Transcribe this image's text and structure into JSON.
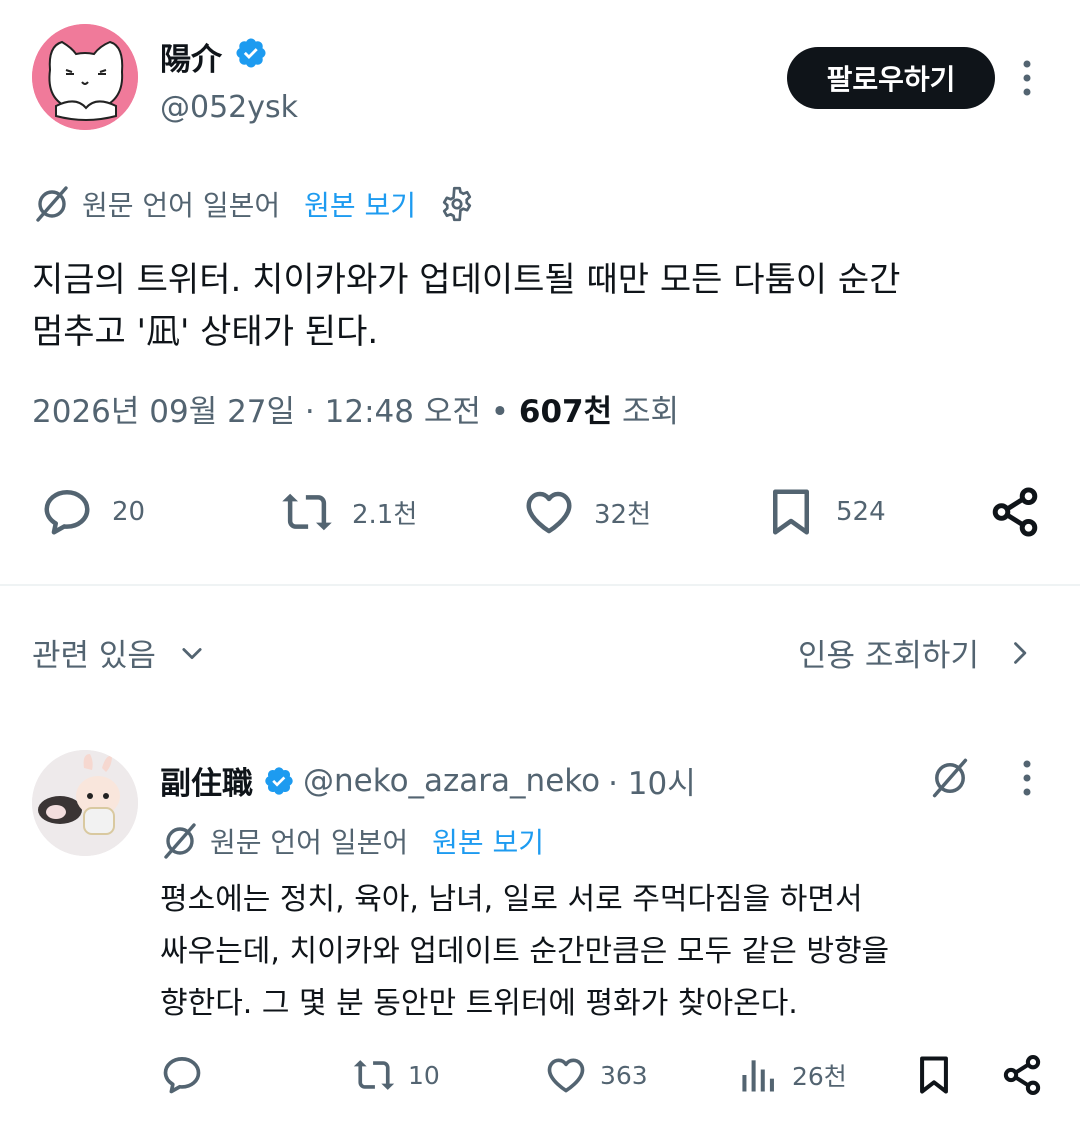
{
  "tweet": {
    "author_name": "陽介",
    "author_handle": "@052ysk",
    "follow_label": "팔로우하기",
    "translation": {
      "source_label": "원문 언어 일본어",
      "show_original": "원본 보기"
    },
    "body_line1": "지금의 트위터. 치이카와가 업데이트될 때만 모든 다툼이 순간",
    "body_line2": "멈추고 '凪' 상태가 된다.",
    "date": "2026년 09월 27일",
    "time": "12:48 오전",
    "views_count": "607천",
    "views_label": "조회",
    "sep": "·",
    "dot": "•",
    "replies": "20",
    "retweets": "2.1천",
    "likes": "32천",
    "bookmarks": "524"
  },
  "related_label": "관련 있음",
  "quote_views_label": "인용 조회하기",
  "reply": {
    "author_name": "副住職",
    "author_handle": "@neko_azara_neko",
    "time": "· 10시",
    "translation": {
      "source_label": "원문 언어 일본어",
      "show_original": "원본 보기"
    },
    "body_line1": "평소에는 정치, 육아, 남녀, 일로 서로 주먹다짐을 하면서",
    "body_line2": "싸우는데, 치이카와 업데이트 순간만큼은 모두 같은 방향을",
    "body_line3": "향한다. 그 몇 분 동안만 트위터에 평화가 찾아온다.",
    "retweets": "10",
    "likes": "363",
    "views": "26천"
  },
  "colors": {
    "accent": "#1d9bf0",
    "text": "#0f1419",
    "muted": "#536471",
    "avatar_bg": "#f07a9a"
  },
  "icons": [
    "verified-icon",
    "translate-icon",
    "gear-icon",
    "reply-icon",
    "retweet-icon",
    "like-icon",
    "bookmark-icon",
    "share-icon",
    "views-icon",
    "chevron-down-icon",
    "chevron-right-icon",
    "more-icon",
    "grok-icon"
  ]
}
